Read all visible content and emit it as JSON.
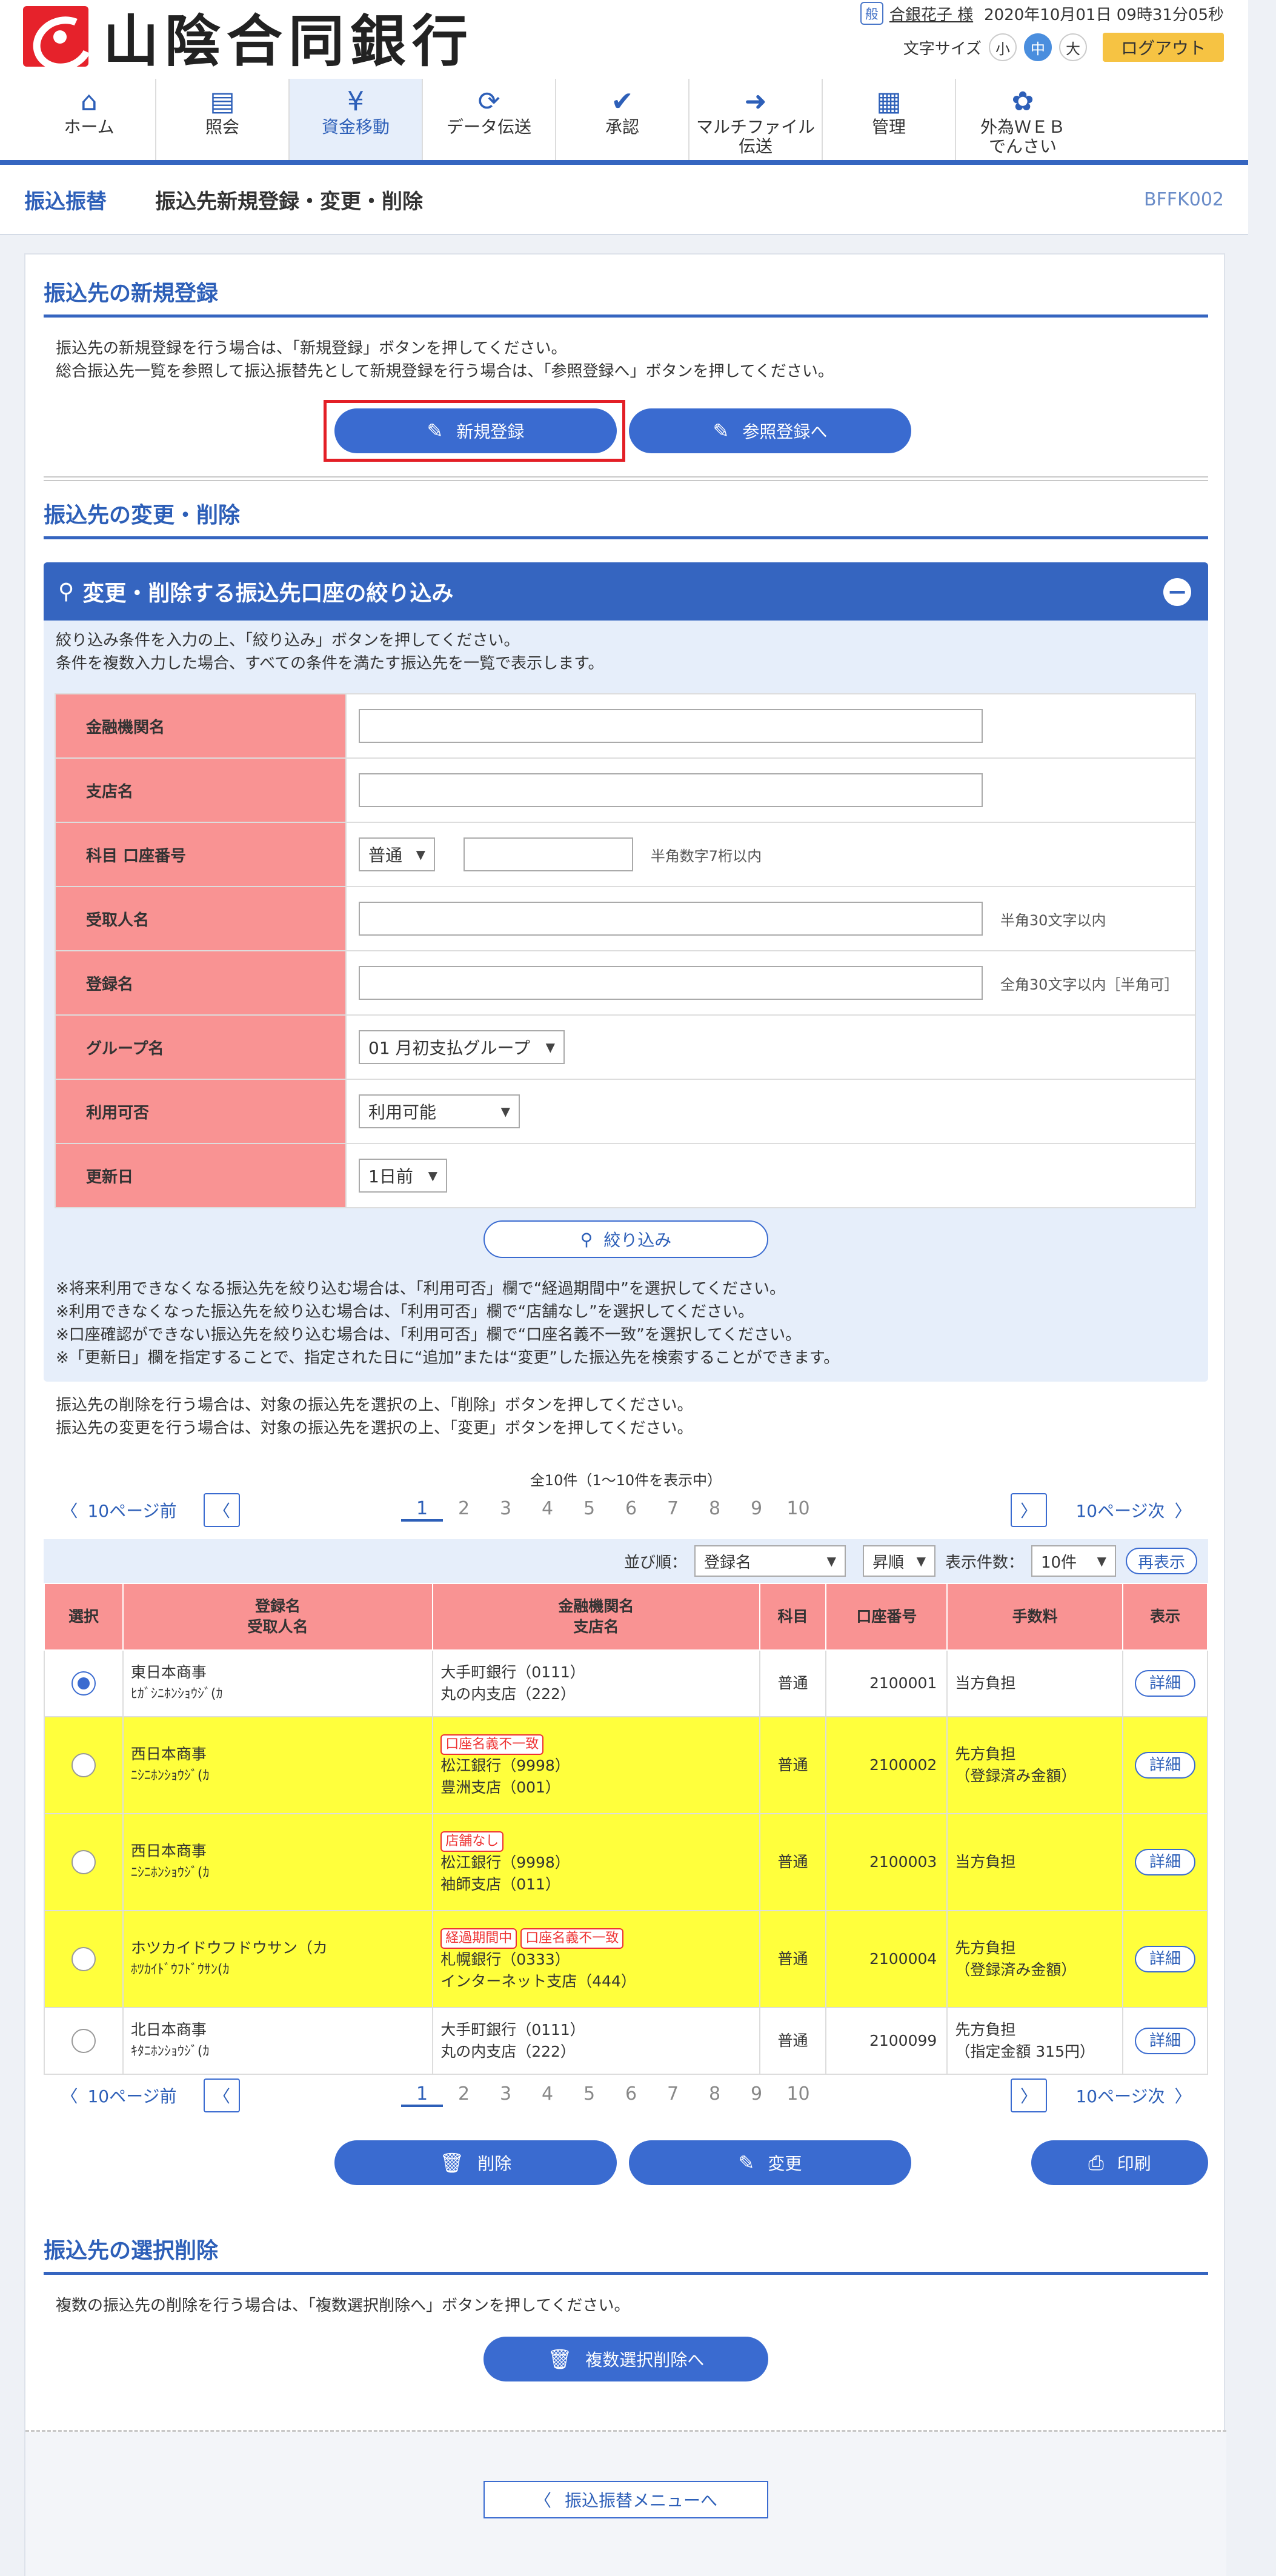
{
  "header": {
    "bank_name": "山陰合同銀行",
    "user_icon": "user-badge-icon",
    "user_icon_text": "般",
    "user_name": "合銀花子 様",
    "datetime": "2020年10月01日 09時31分05秒",
    "font_size_label": "文字サイズ",
    "font_sizes": [
      "小",
      "中",
      "大"
    ],
    "logout": "ログアウト"
  },
  "nav": [
    {
      "label": "ホーム",
      "icon": "home-icon",
      "glyph": "⌂"
    },
    {
      "label": "照会",
      "icon": "document-icon",
      "glyph": "▤"
    },
    {
      "label": "資金移動",
      "icon": "yen-transfer-icon",
      "glyph": "¥"
    },
    {
      "label": "データ伝送",
      "icon": "sync-icon",
      "glyph": "⟳"
    },
    {
      "label": "承認",
      "icon": "approval-icon",
      "glyph": "✔"
    },
    {
      "label": "マルチファイル\n伝送",
      "icon": "file-send-icon",
      "glyph": "➜"
    },
    {
      "label": "管理",
      "icon": "building-icon",
      "glyph": "▦"
    },
    {
      "label": "外為ＷＥＢ\nでんさい",
      "icon": "globe-icon",
      "glyph": "✿"
    }
  ],
  "titlebar": {
    "crumb": "振込振替",
    "title": "振込先新規登録・変更・削除",
    "screen_id": "BFFK002"
  },
  "new_reg": {
    "heading": "振込先の新規登録",
    "text1": "振込先の新規登録を行う場合は、「新規登録」ボタンを押してください。",
    "text2": "総合振込先一覧を参照して振込振替先として新規登録を行う場合は、「参照登録へ」ボタンを押してください。",
    "btn_new": "新規登録",
    "btn_ref": "参照登録へ"
  },
  "change_del": {
    "heading": "振込先の変更・削除"
  },
  "filter": {
    "heading": "変更・削除する振込先口座の絞り込み",
    "collapse": "−",
    "text1": "絞り込み条件を入力の上、「絞り込み」ボタンを押してください。",
    "text2": "条件を複数入力した場合、すべての条件を満たす振込先を一覧で表示します。",
    "labels": {
      "bank": "金融機関名",
      "branch": "支店名",
      "account": "科目 口座番号",
      "payee": "受取人名",
      "regname": "登録名",
      "group": "グループ名",
      "avail": "利用可否",
      "updated": "更新日"
    },
    "account_type": "普通",
    "account_hint": "半角数字7桁以内",
    "payee_hint": "半角30文字以内",
    "regname_hint": "全角30文字以内［半角可］",
    "group_value": "01 月初支払グループ",
    "avail_value": "利用可能",
    "updated_value": "1日前",
    "btn_filter": "絞り込み",
    "notes": [
      "※将来利用できなくなる振込先を絞り込む場合は、「利用可否」欄で“経過期間中”を選択してください。",
      "※利用できなくなった振込先を絞り込む場合は、「利用可否」欄で“店舗なし”を選択してください。",
      "※口座確認ができない振込先を絞り込む場合は、「利用可否」欄で“口座名義不一致”を選択してください。",
      "※「更新日」欄を指定することで、指定された日に“追加”または“変更”した振込先を検索することができます。"
    ]
  },
  "list": {
    "text1": "振込先の削除を行う場合は、対象の振込先を選択の上、「削除」ボタンを押してください。",
    "text2": "振込先の変更を行う場合は、対象の振込先を選択の上、「変更」ボタンを押してください。",
    "count": "全10件（1〜10件を表示中）",
    "prev10": "10ページ前",
    "next10": "10ページ次",
    "pages": [
      "1",
      "2",
      "3",
      "4",
      "5",
      "6",
      "7",
      "8",
      "9",
      "10"
    ],
    "sort_label": "並び順：",
    "sort_value": "登録名",
    "order_value": "昇順",
    "per_page_label": "表示件数：",
    "per_page_value": "10件",
    "redisplay": "再表示",
    "headers": {
      "select": "選択",
      "regname": "登録名",
      "payee": "受取人名",
      "bank": "金融機関名",
      "branch": "支店名",
      "type": "科目",
      "account": "口座番号",
      "fee": "手数料",
      "show": "表示"
    },
    "rows": [
      {
        "reg": "東日本商事",
        "kana": "ﾋｶﾞｼﾆﾎﾝｼｮｳｼﾞ(ｶ",
        "tags": [],
        "bank": "大手町銀行（0111）",
        "branch": "丸の内支店（222）",
        "type": "普通",
        "acct": "2100001",
        "fee1": "当方負担",
        "fee2": "",
        "detail": "詳細",
        "selected": true,
        "highlight": false
      },
      {
        "reg": "西日本商事",
        "kana": "ﾆｼﾆﾎﾝｼｮｳｼﾞ(ｶ",
        "tags": [
          "口座名義不一致"
        ],
        "bank": "松江銀行（9998）",
        "branch": "豊洲支店（001）",
        "type": "普通",
        "acct": "2100002",
        "fee1": "先方負担",
        "fee2": "（登録済み金額）",
        "detail": "詳細",
        "selected": false,
        "highlight": true
      },
      {
        "reg": "西日本商事",
        "kana": "ﾆｼﾆﾎﾝｼｮｳｼﾞ(ｶ",
        "tags": [
          "店舗なし"
        ],
        "bank": "松江銀行（9998）",
        "branch": "袖師支店（011）",
        "type": "普通",
        "acct": "2100003",
        "fee1": "当方負担",
        "fee2": "",
        "detail": "詳細",
        "selected": false,
        "highlight": true
      },
      {
        "reg": "ホツカイドウフドウサン（カ",
        "kana": "ﾎﾂｶｲﾄﾞｳﾌﾄﾞｳｻﾝ(ｶ",
        "tags": [
          "経過期間中",
          "口座名義不一致"
        ],
        "bank": "札幌銀行（0333）",
        "branch": "インターネット支店（444）",
        "type": "普通",
        "acct": "2100004",
        "fee1": "先方負担",
        "fee2": "（登録済み金額）",
        "detail": "詳細",
        "selected": false,
        "highlight": true
      },
      {
        "reg": "北日本商事",
        "kana": "ｷﾀﾆﾎﾝｼｮｳｼﾞ(ｶ",
        "tags": [],
        "bank": "大手町銀行（0111）",
        "branch": "丸の内支店（222）",
        "type": "普通",
        "acct": "2100099",
        "fee1": "先方負担",
        "fee2": "（指定金額 315円）",
        "detail": "詳細",
        "selected": false,
        "highlight": false
      }
    ],
    "btn_delete": "削除",
    "btn_change": "変更",
    "btn_print": "印刷"
  },
  "multi_del": {
    "heading": "振込先の選択削除",
    "text": "複数の振込先の削除を行う場合は、「複数選択削除へ」ボタンを押してください。",
    "btn": "複数選択削除へ"
  },
  "back": "振込振替メニューへ",
  "colors": {
    "primary": "#3a6bd0",
    "header_red": "#f99393",
    "highlight": "#ffff3c",
    "accent_red": "#e31f26"
  }
}
